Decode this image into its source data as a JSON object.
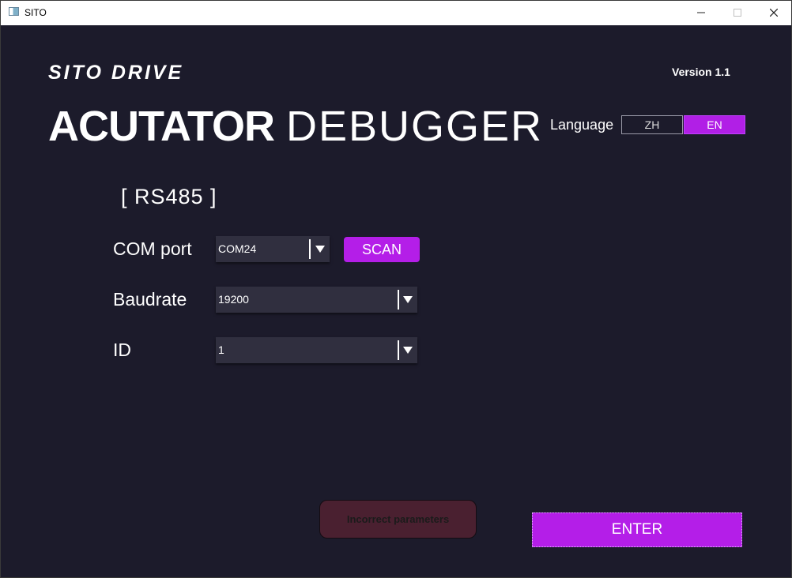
{
  "window": {
    "title": "SITO"
  },
  "brand": {
    "logo": "SITO DRIVE",
    "version": "Version 1.1",
    "headline_strong": "ACUTATOR",
    "headline_light": "DEBUGGER"
  },
  "language": {
    "label": "Language",
    "options": [
      "ZH",
      "EN"
    ],
    "selected": "EN"
  },
  "connection": {
    "section_title": "[ RS485 ]",
    "com_port": {
      "label": "COM port",
      "value": "COM24"
    },
    "scan_label": "SCAN",
    "baudrate": {
      "label": "Baudrate",
      "value": "19200"
    },
    "id": {
      "label": "ID",
      "value": "1"
    }
  },
  "status": {
    "message": "Incorrect parameters"
  },
  "actions": {
    "enter_label": "ENTER"
  },
  "colors": {
    "background": "#1c1b2b",
    "accent": "#b41ee8",
    "field_bg": "#302f3f",
    "error_bg": "#4a2030"
  },
  "icons": {
    "window": "app-window-icon",
    "dropdown": "triangle-down-icon"
  }
}
